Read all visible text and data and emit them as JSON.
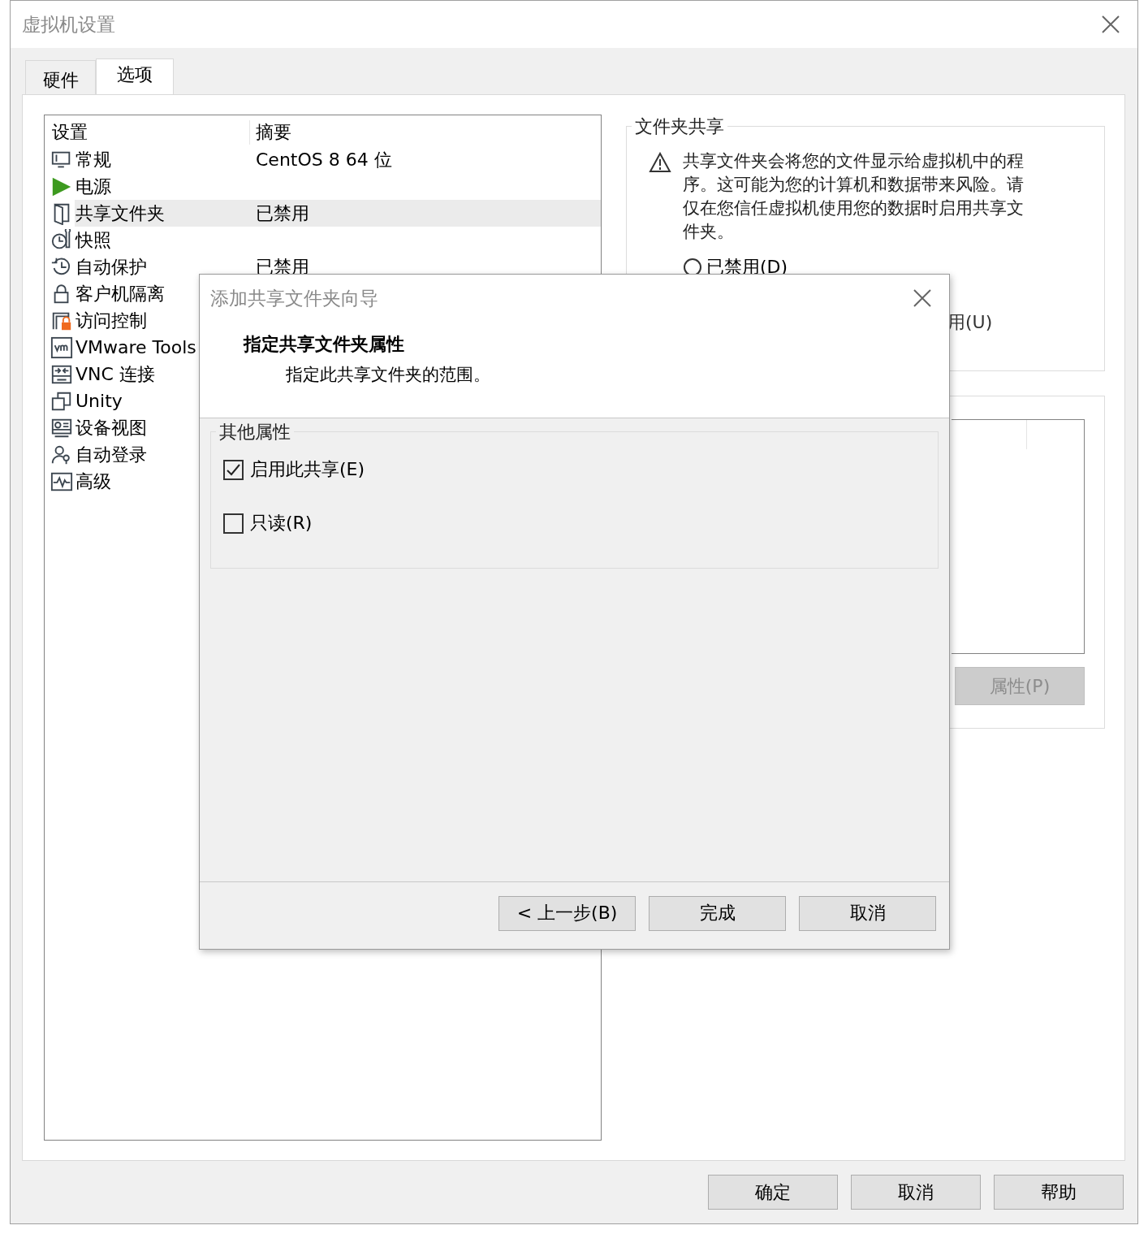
{
  "window": {
    "title": "虚拟机设置"
  },
  "tabs": [
    {
      "label": "硬件",
      "selected": false
    },
    {
      "label": "选项",
      "selected": true
    }
  ],
  "settings_list": {
    "columns": [
      "设置",
      "摘要"
    ],
    "rows": [
      {
        "name": "常规",
        "summary": "CentOS 8 64 位",
        "selected": false
      },
      {
        "name": "电源",
        "selected": false
      },
      {
        "name": "共享文件夹",
        "summary": "已禁用",
        "selected": true
      },
      {
        "name": "快照",
        "selected": false
      },
      {
        "name": "自动保护",
        "summary": "已禁用",
        "selected": false
      },
      {
        "name": "客户机隔离",
        "selected": false
      },
      {
        "name": "访问控制",
        "selected": false
      },
      {
        "name": "VMware Tools",
        "selected": false
      },
      {
        "name": "VNC 连接",
        "selected": false
      },
      {
        "name": "Unity",
        "selected": false
      },
      {
        "name": "设备视图",
        "selected": false
      },
      {
        "name": "自动登录",
        "selected": false
      },
      {
        "name": "高级",
        "selected": false
      }
    ]
  },
  "folder_sharing": {
    "title": "文件夹共享",
    "warning": "共享文件夹会将您的文件显示给虚拟机中的程序。这可能为您的计算机和数据带来风险。请仅在您信任虚拟机使用您的数据时启用共享文件夹。",
    "options": [
      {
        "label": "已禁用(D)",
        "selected": false
      }
    ],
    "partial_option_label": "用(U)"
  },
  "folders_group": {
    "button": {
      "label": "属性(P)",
      "disabled": true
    }
  },
  "buttons": [
    {
      "label": "确定"
    },
    {
      "label": "取消"
    },
    {
      "label": "帮助"
    }
  ],
  "wizard": {
    "title": "添加共享文件夹向导",
    "heading": "指定共享文件夹属性",
    "subheading": "指定此共享文件夹的范围。",
    "group": {
      "title": "其他属性",
      "options": [
        {
          "label": "启用此共享(E)",
          "checked": true
        },
        {
          "label": "只读(R)",
          "checked": false
        }
      ]
    },
    "buttons": [
      {
        "label": "< 上一步(B)"
      },
      {
        "label": "完成"
      },
      {
        "label": "取消"
      }
    ]
  }
}
